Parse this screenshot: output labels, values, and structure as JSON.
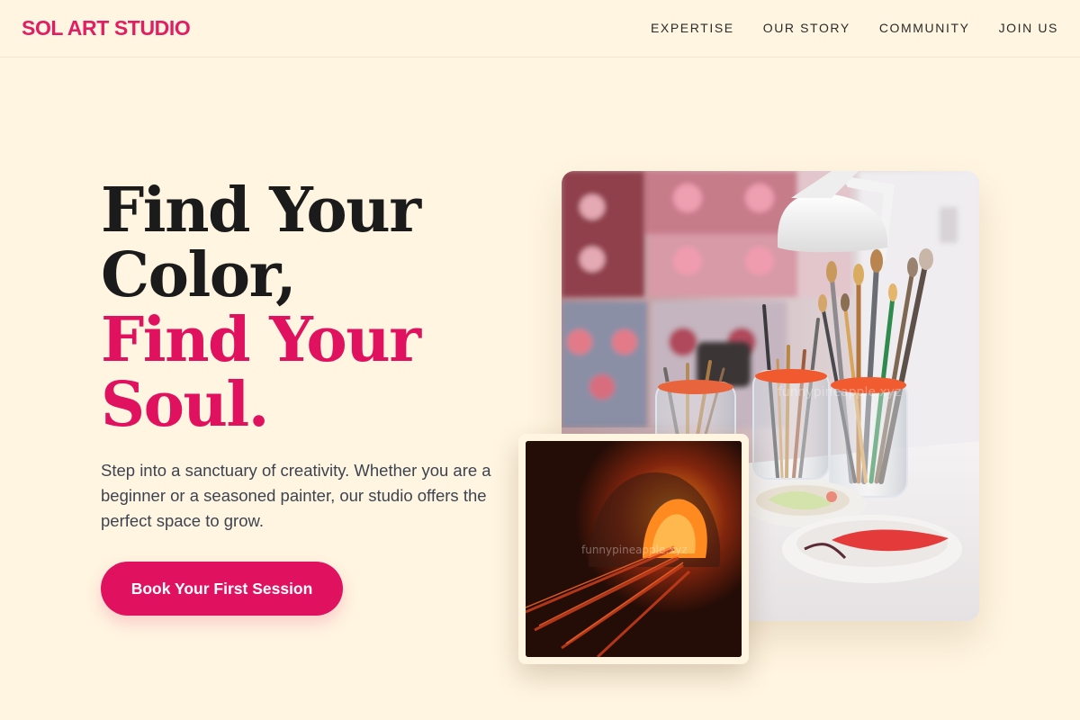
{
  "brand": {
    "name": "SOL ART STUDIO"
  },
  "nav": {
    "items": [
      {
        "label": "EXPERTISE"
      },
      {
        "label": "OUR STORY"
      },
      {
        "label": "COMMUNITY"
      },
      {
        "label": "JOIN US"
      }
    ]
  },
  "hero": {
    "headline_line1": "Find Your",
    "headline_line2": "Color,",
    "headline_line3": "Find Your",
    "headline_line4": "Soul.",
    "description": "Step into a sanctuary of creativity. Whether you are a beginner or a seasoned painter, our studio offers the perfect space to grow.",
    "cta_label": "Book Your First Session"
  },
  "images": {
    "main_photo": "studio-brushes-photo",
    "secondary_photo": "kiln-fire-photo",
    "watermark": "funnypineapple.xyz"
  },
  "colors": {
    "accent": "#e0115f",
    "background": "#fff5e1",
    "headline": "#1b1b1b",
    "body_text": "#3d4451"
  }
}
